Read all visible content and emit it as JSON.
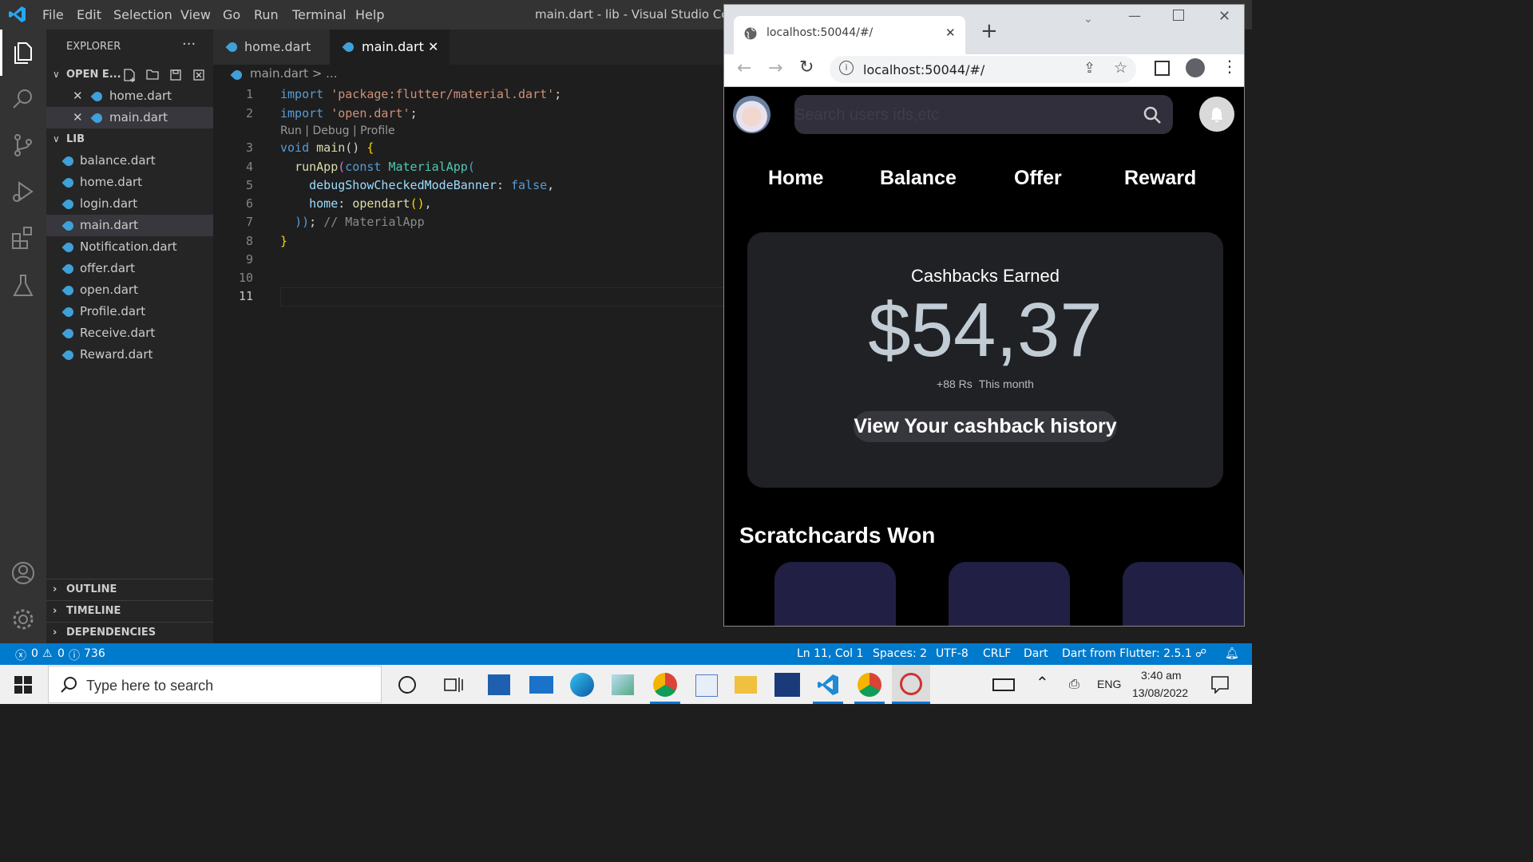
{
  "vscode": {
    "menu": [
      "File",
      "Edit",
      "Selection",
      "View",
      "Go",
      "Run",
      "Terminal",
      "Help"
    ],
    "window_title": "main.dart - lib - Visual Studio Code",
    "explorer": {
      "title": "EXPLORER",
      "more": "···",
      "open_editors_label": "OPEN E...",
      "open_editors": [
        "home.dart",
        "main.dart"
      ],
      "folder_label": "LIB",
      "files": [
        "balance.dart",
        "home.dart",
        "login.dart",
        "main.dart",
        "Notification.dart",
        "offer.dart",
        "open.dart",
        "Profile.dart",
        "Receive.dart",
        "Reward.dart"
      ],
      "selected_file": "main.dart",
      "sections": [
        "OUTLINE",
        "TIMELINE",
        "DEPENDENCIES"
      ]
    },
    "tabs": [
      {
        "label": "home.dart",
        "active": false
      },
      {
        "label": "main.dart",
        "active": true
      }
    ],
    "close_glyph": "✕",
    "breadcrumb": {
      "file": "main.dart",
      "sep": ">",
      "rest": "..."
    },
    "codelens": "Run | Debug | Profile",
    "code": {
      "l1": {
        "kw": "import",
        "str": "'package:flutter/material.dart'",
        "end": ";"
      },
      "l2": {
        "kw": "import",
        "str": "'open.dart'",
        "end": ";"
      },
      "l3": {
        "kw": "void",
        "fn": "main",
        "rest": "() ",
        "brace": "{"
      },
      "l4": {
        "fn": "runApp",
        "open": "(",
        "kw": "const",
        "cls": "MaterialApp",
        "open2": "("
      },
      "l5": {
        "prm": "debugShowCheckedModeBanner",
        "sep": ": ",
        "kw": "false",
        "end": ","
      },
      "l6": {
        "prm": "home",
        "sep": ": ",
        "fn": "opendart",
        "call": "()",
        "end": ","
      },
      "l7": {
        "close": "))",
        "semi": ";",
        "comment": "// MaterialApp"
      },
      "l8": {
        "brace": "}"
      }
    },
    "line_numbers": [
      "1",
      "2",
      "3",
      "4",
      "5",
      "6",
      "7",
      "8",
      "9",
      "10",
      "11"
    ],
    "status": {
      "errors": "0",
      "warnings": "0",
      "info": "736",
      "position": "Ln 11, Col 1",
      "spaces": "Spaces: 2",
      "encoding": "UTF-8",
      "eol": "CRLF",
      "language": "Dart",
      "sdk": "Dart from Flutter: 2.5.1"
    }
  },
  "browser": {
    "tab_title": "localhost:50044/#/",
    "url": "localhost:50044/#/",
    "tab_close": "✕",
    "new_tab": "+",
    "app": {
      "search_placeholder": "Search users ids,etc",
      "nav": [
        "Home",
        "Balance",
        "Offer",
        "Reward"
      ],
      "card": {
        "title": "Cashbacks Earned",
        "amount": "$54,37",
        "delta": "+88 Rs",
        "period": "This month",
        "button": "View Your cashback history"
      },
      "section_title": "Scratchcards Won",
      "colors": {
        "card_bg": "#202124",
        "scratch_bg": "#221f45",
        "amount": "#c2ccd5",
        "search_bg": "#302f3b"
      }
    }
  },
  "taskbar": {
    "search_placeholder": "Type here to search",
    "language": "ENG",
    "time": "3:40 am",
    "date": "13/08/2022"
  }
}
